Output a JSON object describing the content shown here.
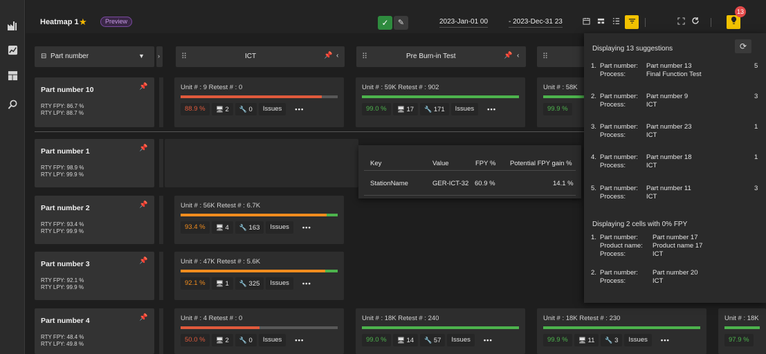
{
  "header": {
    "title": "Heatmap 1",
    "star_icon": "star-icon",
    "preview_badge": "Preview",
    "date_from": "2023-Jan-01 00",
    "date_to": "- 2023-Dec-31 23",
    "notification_count": "13",
    "accent_color": "#f3c200"
  },
  "rail": {
    "icons": [
      "factory-icon",
      "chart-icon",
      "dashboard-icon",
      "search-icon"
    ]
  },
  "columns": {
    "row_header_label": "Part number",
    "c1": "ICT",
    "c2": "Pre Burn-in Test"
  },
  "rows": [
    {
      "name": "Part number 10",
      "rty": "RTY FPY: 86.7 %",
      "rty_lpy": "RTY LPY: 88.7 %",
      "cells": [
        {
          "unit": "Unit # : 9   Retest # : 0",
          "pct": "88.9 %",
          "stations": "2",
          "repairs": "0",
          "issues": "Issues",
          "fill": 0.9,
          "color": "#e05a3c",
          "pct_color": "#e05a3c"
        },
        {
          "unit": "Unit # : 59K   Retest # : 902",
          "pct": "99.0 %",
          "stations": "17",
          "repairs": "171",
          "issues": "Issues",
          "fill": 1.0,
          "color": "#4db34d",
          "pct_color": "#4db34d"
        },
        {
          "unit": "Unit # : 58K",
          "pct": "99.9 %",
          "stations": "",
          "repairs": "",
          "issues": "",
          "fill": 1.0,
          "color": "#4db34d",
          "pct_color": "#4db34d"
        }
      ]
    },
    {
      "name": "Part number 1",
      "rty": "RTY FPY: 98.9 %",
      "rty_lpy": "RTY LPY: 99.9 %",
      "cells": []
    },
    {
      "name": "Part number 2",
      "rty": "RTY FPY: 93.4 %",
      "rty_lpy": "RTY LPY: 99.9 %",
      "cells": [
        {
          "unit": "Unit # : 56K   Retest # : 6.7K",
          "pct": "93.4 %",
          "stations": "4",
          "repairs": "163",
          "issues": "Issues",
          "fill": 0.93,
          "color": "#f08c1e",
          "pct_color": "#f08c1e"
        }
      ]
    },
    {
      "name": "Part number 3",
      "rty": "RTY FPY: 92.1 %",
      "rty_lpy": "RTY LPY: 99.9 %",
      "cells": [
        {
          "unit": "Unit # : 47K   Retest # : 5.6K",
          "pct": "92.1 %",
          "stations": "1",
          "repairs": "325",
          "issues": "Issues",
          "fill": 0.92,
          "color": "#f08c1e",
          "pct_color": "#f08c1e"
        }
      ]
    },
    {
      "name": "Part number 4",
      "rty": "RTY FPY: 48.4 %",
      "rty_lpy": "RTY LPY: 49.8 %",
      "cells": [
        {
          "unit": "Unit # : 4   Retest # : 0",
          "pct": "50.0 %",
          "stations": "2",
          "repairs": "0",
          "issues": "Issues",
          "fill": 0.5,
          "color": "#e05a3c",
          "pct_color": "#e05a3c"
        },
        {
          "unit": "Unit # : 18K   Retest # : 240",
          "pct": "99.0 %",
          "stations": "14",
          "repairs": "57",
          "issues": "Issues",
          "fill": 1.0,
          "color": "#4db34d",
          "pct_color": "#4db34d"
        },
        {
          "unit": "Unit # : 18K   Retest # : 230",
          "pct": "99.9 %",
          "stations": "11",
          "repairs": "3",
          "issues": "Issues",
          "fill": 1.0,
          "color": "#4db34d",
          "pct_color": "#4db34d"
        },
        {
          "unit": "Unit # : 18K",
          "pct": "97.9 %",
          "stations": "",
          "repairs": "",
          "issues": "",
          "fill": 1.0,
          "color": "#4db34d",
          "pct_color": "#4db34d"
        }
      ]
    }
  ],
  "popup": {
    "headers": [
      "Key",
      "Value",
      "FPY %",
      "Potential FPY gain %"
    ],
    "row": [
      "StationName",
      "GER-ICT-32",
      "60.9 %",
      "14.1 %"
    ]
  },
  "suggestions": {
    "title": "Displaying 13 suggestions",
    "items": [
      {
        "idx": "1.",
        "part_label": "Part number:",
        "part": "Part number 13",
        "proc_label": "Process:",
        "process": "Final Function Test",
        "count": "5"
      },
      {
        "idx": "2.",
        "part_label": "Part number:",
        "part": "Part number 9",
        "proc_label": "Process:",
        "process": "ICT",
        "count": "3"
      },
      {
        "idx": "3.",
        "part_label": "Part number:",
        "part": "Part number 23",
        "proc_label": "Process:",
        "process": "ICT",
        "count": "1"
      },
      {
        "idx": "4.",
        "part_label": "Part number:",
        "part": "Part number 18",
        "proc_label": "Process:",
        "process": "ICT",
        "count": "1"
      },
      {
        "idx": "5.",
        "part_label": "Part number:",
        "part": "Part number 11",
        "proc_label": "Process:",
        "process": "ICT",
        "count": "3"
      }
    ],
    "zero_title": "Displaying 2 cells with 0% FPY",
    "zero_items": [
      {
        "idx": "1.",
        "part_label": "Part number:",
        "part": "Part number 17",
        "prod_label": "Product name:",
        "product": "Product name 17",
        "proc_label": "Process:",
        "process": "ICT"
      },
      {
        "idx": "2.",
        "part_label": "Part number:",
        "part": "Part number 20",
        "proc_label": "Process:",
        "process": "ICT"
      }
    ]
  }
}
